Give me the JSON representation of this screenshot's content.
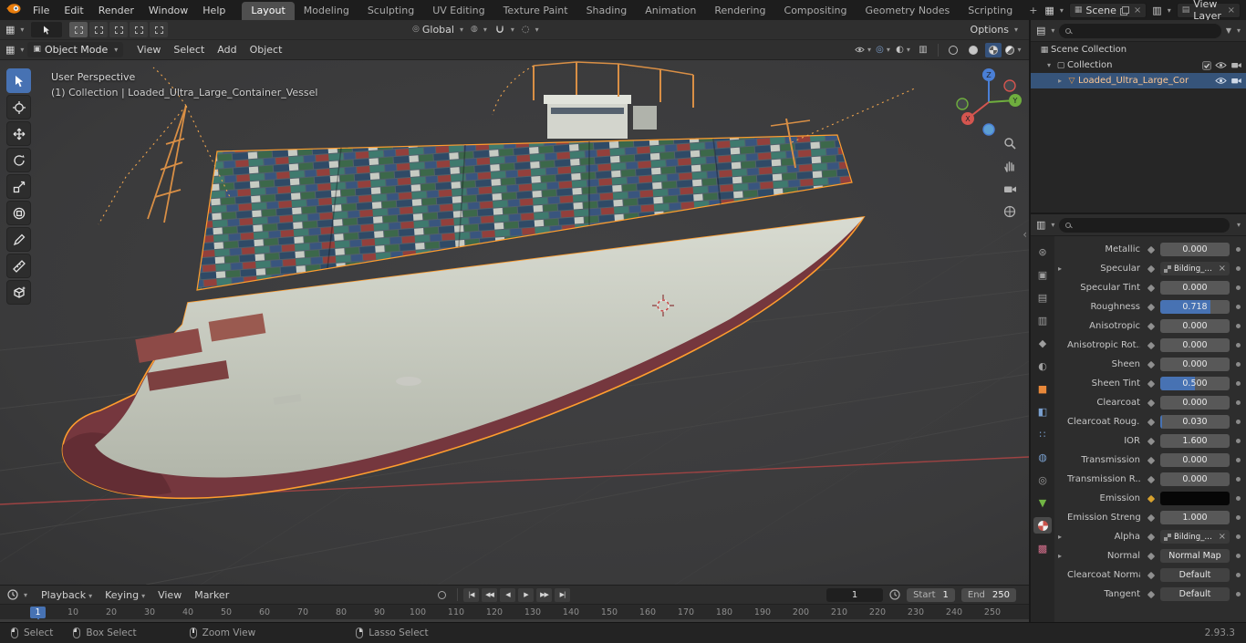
{
  "topbar": {
    "menus": [
      "File",
      "Edit",
      "Render",
      "Window",
      "Help"
    ],
    "workspaces": [
      "Layout",
      "Modeling",
      "Sculpting",
      "UV Editing",
      "Texture Paint",
      "Shading",
      "Animation",
      "Rendering",
      "Compositing",
      "Geometry Nodes",
      "Scripting"
    ],
    "active_workspace": "Layout",
    "add_workspace": "+",
    "scene": "Scene",
    "view_layer": "View Layer"
  },
  "tool_settings": {
    "orientation": "Global",
    "options": "Options"
  },
  "viewport": {
    "header": {
      "mode": "Object Mode",
      "menus": [
        "View",
        "Select",
        "Add",
        "Object"
      ]
    },
    "overlay": {
      "perspective": "User Perspective",
      "context": "(1) Collection | Loaded_Ultra_Large_Container_Vessel"
    },
    "gizmo": {
      "x": "X",
      "y": "Y",
      "z": "Z"
    }
  },
  "outliner": {
    "tree": {
      "root": "Scene Collection",
      "collection": "Collection",
      "object": "Loaded_Ultra_Large_Cor"
    }
  },
  "properties": {
    "rows": [
      {
        "label": "Metallic",
        "value": "0.000",
        "kind": "slider",
        "fill": 0
      },
      {
        "label": "Specular",
        "value": "Bilding_To...ecular.png",
        "kind": "texture",
        "expand": true
      },
      {
        "label": "Specular Tint",
        "value": "0.000",
        "kind": "slider",
        "fill": 0
      },
      {
        "label": "Roughness",
        "value": "0.718",
        "kind": "slider",
        "fill": 0.718
      },
      {
        "label": "Anisotropic",
        "value": "0.000",
        "kind": "slider",
        "fill": 0
      },
      {
        "label": "Anisotropic Rot...",
        "value": "0.000",
        "kind": "slider",
        "fill": 0
      },
      {
        "label": "Sheen",
        "value": "0.000",
        "kind": "slider",
        "fill": 0
      },
      {
        "label": "Sheen Tint",
        "value": "0.500",
        "kind": "slider",
        "fill": 0.5
      },
      {
        "label": "Clearcoat",
        "value": "0.000",
        "kind": "slider",
        "fill": 0
      },
      {
        "label": "Clearcoat Roug...",
        "value": "0.030",
        "kind": "slider",
        "fill": 0.03
      },
      {
        "label": "IOR",
        "value": "1.600",
        "kind": "slider",
        "fill": 0
      },
      {
        "label": "Transmission",
        "value": "0.000",
        "kind": "slider",
        "fill": 0
      },
      {
        "label": "Transmission R...",
        "value": "0.000",
        "kind": "slider",
        "fill": 0
      },
      {
        "label": "Emission",
        "value": "",
        "kind": "color",
        "dot": "#d8a22e"
      },
      {
        "label": "Emission Strengt",
        "value": "1.000",
        "kind": "slider",
        "fill": 0
      },
      {
        "label": "Alpha",
        "value": "Bilding_To...pacity.png",
        "kind": "texture",
        "expand": true
      },
      {
        "label": "Normal",
        "value": "Normal Map",
        "kind": "menu",
        "expand": true
      },
      {
        "label": "Clearcoat Normal",
        "value": "Default",
        "kind": "menu"
      },
      {
        "label": "Tangent",
        "value": "Default",
        "kind": "menu"
      }
    ]
  },
  "timeline": {
    "menus": [
      "Playback",
      "Keying",
      "View",
      "Marker"
    ],
    "transport": [
      "|◀",
      "◀◀",
      "◀",
      "▶",
      "▶▶",
      "▶|"
    ],
    "current_frame": "1",
    "start": {
      "label": "Start",
      "value": "1"
    },
    "end": {
      "label": "End",
      "value": "250"
    },
    "ticks": [
      "10",
      "20",
      "30",
      "40",
      "50",
      "60",
      "70",
      "80",
      "90",
      "100",
      "110",
      "120",
      "130",
      "140",
      "150",
      "160",
      "170",
      "180",
      "190",
      "200",
      "210",
      "220",
      "230",
      "240",
      "250"
    ]
  },
  "statusbar": {
    "hints": [
      "Select",
      "Box Select",
      "Zoom View",
      "Lasso Select"
    ],
    "version": "2.93.3"
  },
  "colors": {
    "accent": "#4772b3",
    "selection_outline": "#ff9d2e"
  }
}
